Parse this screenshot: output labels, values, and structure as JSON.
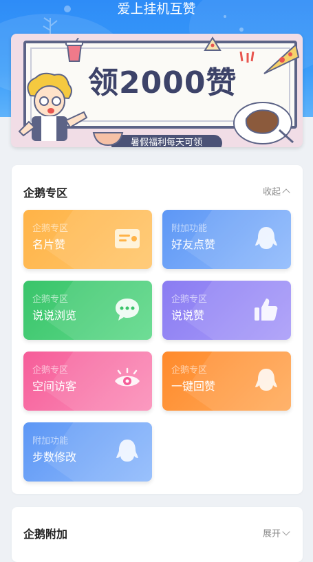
{
  "app": {
    "title": "爱上挂机互赞"
  },
  "banner": {
    "headline": "领2000赞",
    "subtitle": "暑假福利每天可领"
  },
  "sections": [
    {
      "title": "企鹅专区",
      "toggle_label": "收起",
      "tiles": [
        {
          "category": "企鹅专区",
          "name": "名片赞",
          "icon": "card-icon"
        },
        {
          "category": "附加功能",
          "name": "好友点赞",
          "icon": "penguin-icon"
        },
        {
          "category": "企鹅专区",
          "name": "说说浏览",
          "icon": "chat-bubble-icon"
        },
        {
          "category": "企鹅专区",
          "name": "说说赞",
          "icon": "thumbs-up-icon"
        },
        {
          "category": "企鹅专区",
          "name": "空间访客",
          "icon": "eye-icon"
        },
        {
          "category": "企鹅专区",
          "name": "一键回赞",
          "icon": "penguin-icon"
        },
        {
          "category": "附加功能",
          "name": "步数修改",
          "icon": "penguin-icon"
        }
      ]
    },
    {
      "title": "企鹅附加",
      "toggle_label": "展开"
    }
  ]
}
